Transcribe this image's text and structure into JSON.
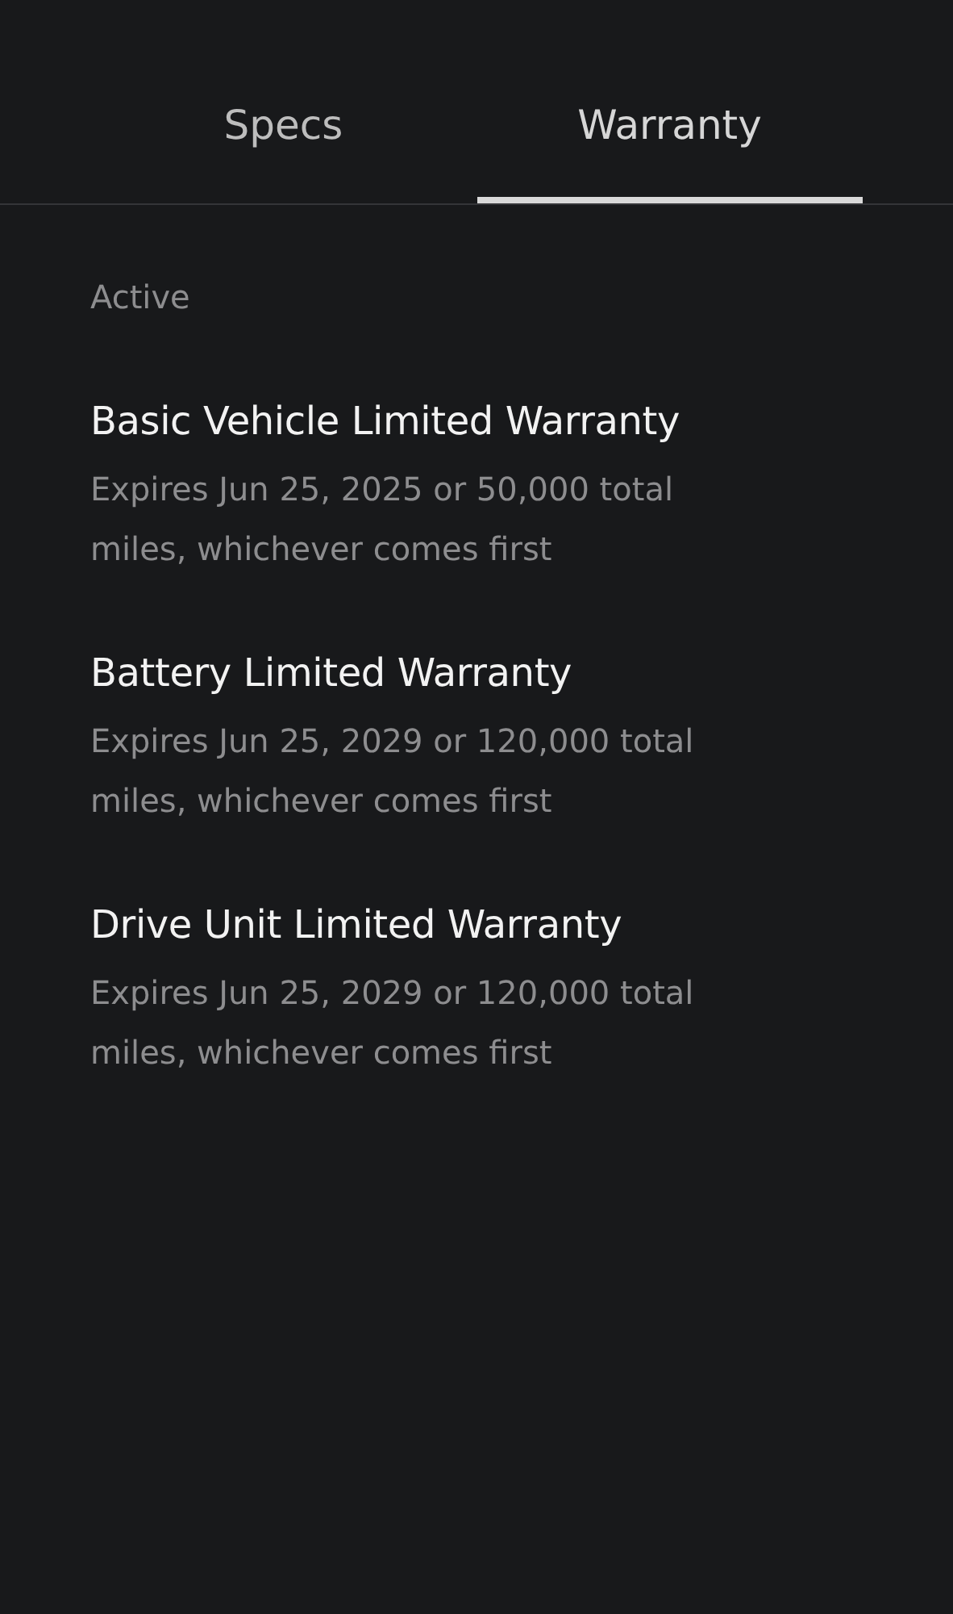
{
  "tabs": [
    {
      "label": "Specs",
      "selected": false
    },
    {
      "label": "Warranty",
      "selected": true
    }
  ],
  "section": {
    "title": "Active",
    "items": [
      {
        "title": "Basic Vehicle Limited Warranty",
        "description": "Expires Jun 25, 2025 or 50,000 total miles, whichever comes first"
      },
      {
        "title": "Battery Limited Warranty",
        "description": "Expires Jun 25, 2029 or 120,000 total miles, whichever comes first"
      },
      {
        "title": "Drive Unit Limited Warranty",
        "description": "Expires Jun 25, 2029 or 120,000 total miles, whichever comes first"
      }
    ]
  }
}
